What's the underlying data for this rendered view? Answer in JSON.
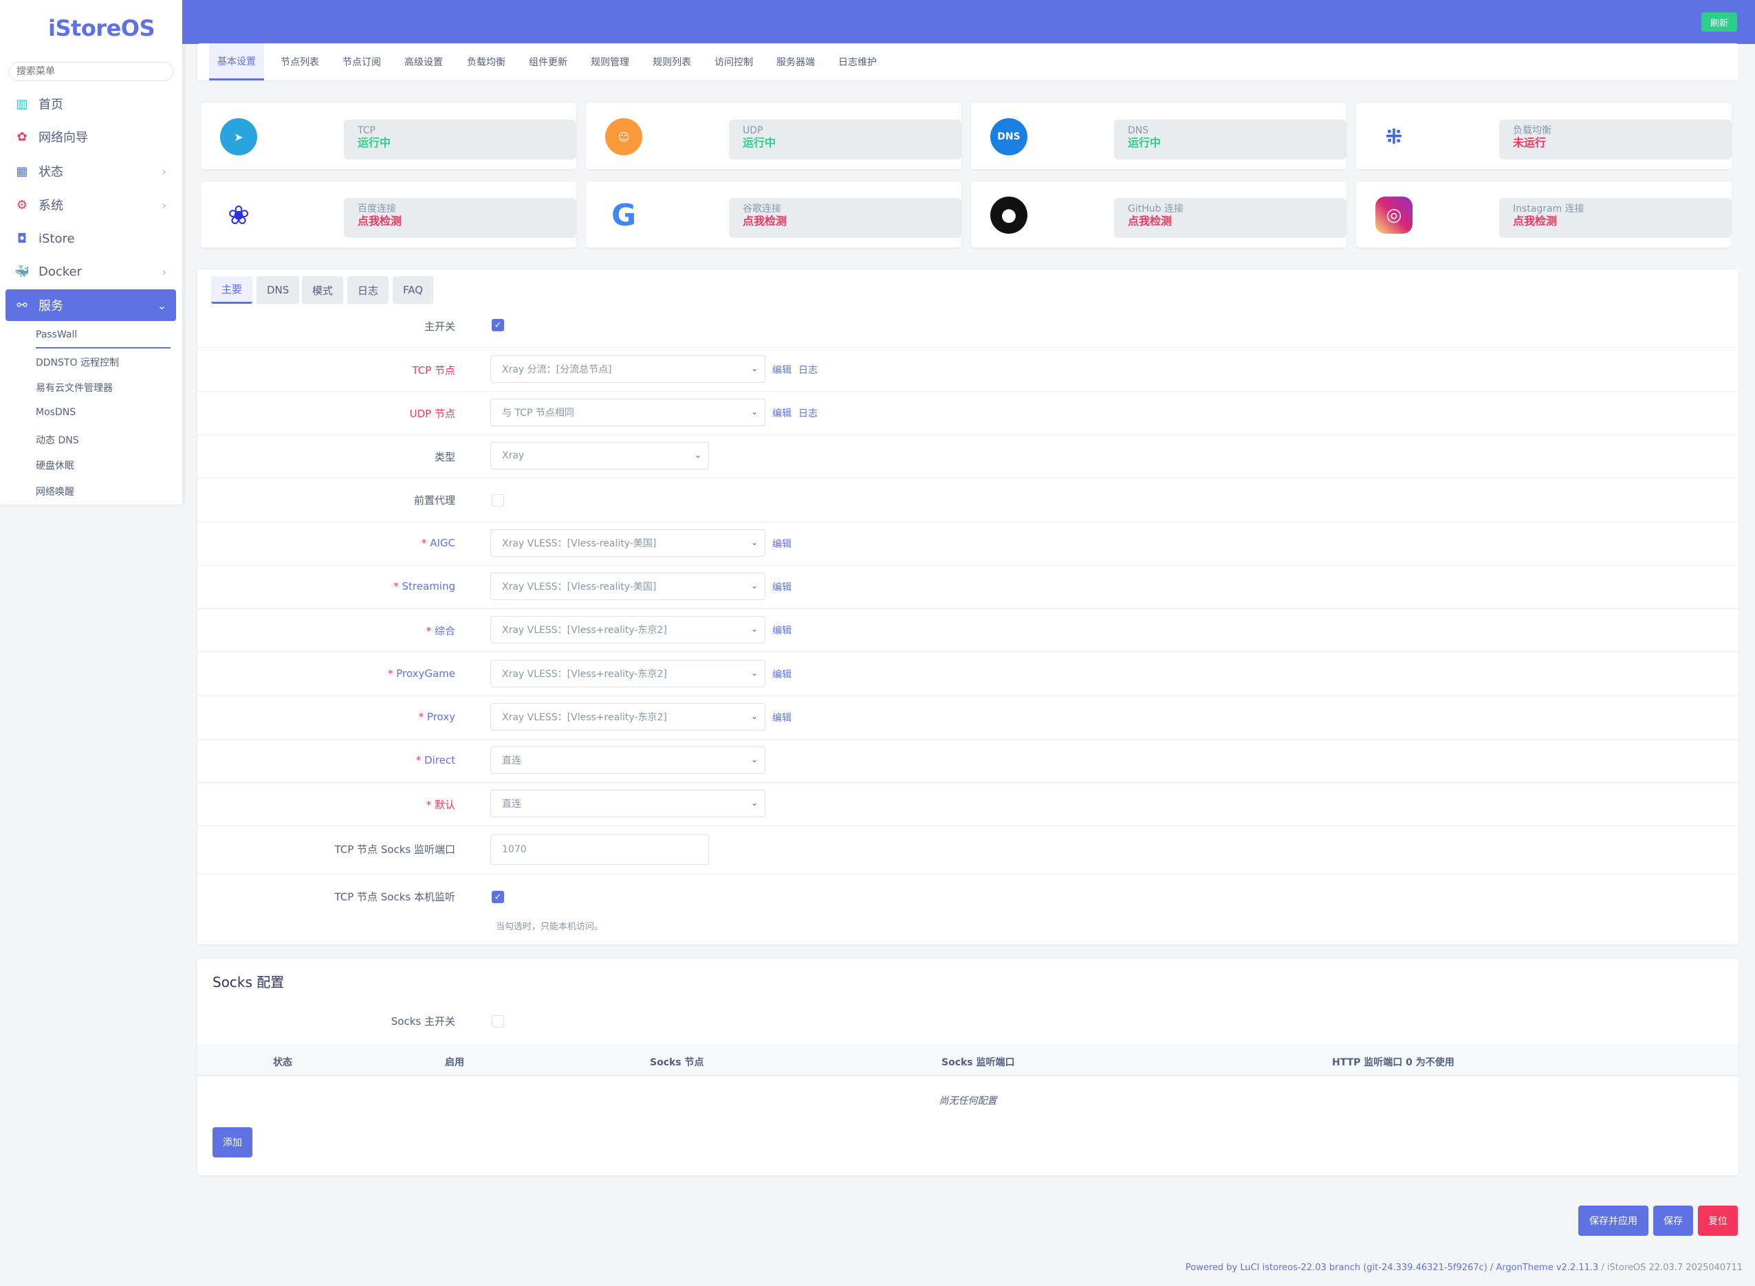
{
  "app": {
    "logo": "iStoreOS",
    "refresh_label": "刷新"
  },
  "sidebar": {
    "search_placeholder": "搜索菜单",
    "items": [
      {
        "label": "首页",
        "icon": "dashboard-icon"
      },
      {
        "label": "网络向导",
        "icon": "wizard-icon"
      },
      {
        "label": "状态",
        "icon": "status-icon"
      },
      {
        "label": "系统",
        "icon": "gear-icon"
      },
      {
        "label": "iStore",
        "icon": "store-icon"
      },
      {
        "label": "Docker",
        "icon": "docker-icon"
      },
      {
        "label": "服务",
        "icon": "services-icon"
      }
    ],
    "sub_items": [
      "PassWall",
      "DDNSTO 远程控制",
      "易有云文件管理器",
      "MosDNS",
      "动态 DNS",
      "硬盘休眠",
      "网络唤醒"
    ]
  },
  "top_tabs": [
    "基本设置",
    "节点列表",
    "节点订阅",
    "高级设置",
    "负载均衡",
    "组件更新",
    "规则管理",
    "规则列表",
    "访问控制",
    "服务器端",
    "日志维护"
  ],
  "status_tiles": [
    {
      "label": "TCP",
      "status": "运行中",
      "state": "green",
      "icon": "telegram-icon"
    },
    {
      "label": "UDP",
      "status": "运行中",
      "state": "green",
      "icon": "gamepad-icon"
    },
    {
      "label": "DNS",
      "status": "运行中",
      "state": "green",
      "icon": "dns-icon"
    },
    {
      "label": "负载均衡",
      "status": "未运行",
      "state": "red",
      "icon": "cluster-icon"
    },
    {
      "label": "百度连接",
      "status": "点我检测",
      "state": "red",
      "icon": "baidu-icon"
    },
    {
      "label": "谷歌连接",
      "status": "点我检测",
      "state": "red",
      "icon": "google-icon"
    },
    {
      "label": "GitHub 连接",
      "status": "点我检测",
      "state": "red",
      "icon": "github-icon"
    },
    {
      "label": "Instagram 连接",
      "status": "点我检测",
      "state": "red",
      "icon": "instagram-icon"
    }
  ],
  "sub_tabs": [
    "主要",
    "DNS",
    "模式",
    "日志",
    "FAQ"
  ],
  "form": {
    "main_switch": {
      "label": "主开关",
      "checked": true
    },
    "tcp_node": {
      "label": "TCP 节点",
      "value": "Xray 分流：[分流总节点]",
      "edit": "编辑",
      "log": "日志"
    },
    "udp_node": {
      "label": "UDP 节点",
      "value": "与 TCP 节点相同",
      "edit": "编辑",
      "log": "日志"
    },
    "type": {
      "label": "类型",
      "value": "Xray"
    },
    "pre_proxy": {
      "label": "前置代理",
      "checked": false
    },
    "aigc": {
      "label": "AIGC",
      "value": "Xray VLESS：[Vless-reality-美国]",
      "edit": "编辑"
    },
    "streaming": {
      "label": "Streaming",
      "value": "Xray VLESS：[Vless-reality-美国]",
      "edit": "编辑"
    },
    "general": {
      "label": "综合",
      "value": "Xray VLESS：[Vless+reality-东京2]",
      "edit": "编辑"
    },
    "proxygame": {
      "label": "ProxyGame",
      "value": "Xray VLESS：[Vless+reality-东京2]",
      "edit": "编辑"
    },
    "proxy": {
      "label": "Proxy",
      "value": "Xray VLESS：[Vless+reality-东京2]",
      "edit": "编辑"
    },
    "direct": {
      "label": "Direct",
      "value": "直连"
    },
    "default": {
      "label": "默认",
      "value": "直连"
    },
    "socks_port": {
      "label": "TCP 节点 Socks 监听端口",
      "value": "1070"
    },
    "socks_local": {
      "label": "TCP 节点 Socks 本机监听",
      "checked": true,
      "hint": "当勾选时，只能本机访问。"
    }
  },
  "socks": {
    "title": "Socks 配置",
    "switch_label": "Socks 主开关",
    "columns": [
      "状态",
      "启用",
      "Socks 节点",
      "Socks 监听端口",
      "HTTP 监听端口 0 为不使用"
    ],
    "empty": "尚无任何配置",
    "add_label": "添加"
  },
  "actions": {
    "save_apply": "保存并应用",
    "save": "保存",
    "reset": "复位"
  },
  "footer": {
    "powered": "Powered by LuCI istoreos-22.03 branch (git-24.339.46321-5f9267c) / ArgonTheme v2.2.11.3",
    "version": " / iStoreOS 22.03.7 2025040711"
  },
  "colors": {
    "accent": "#5e72e4",
    "success": "#2dce89",
    "danger": "#f5365c"
  }
}
